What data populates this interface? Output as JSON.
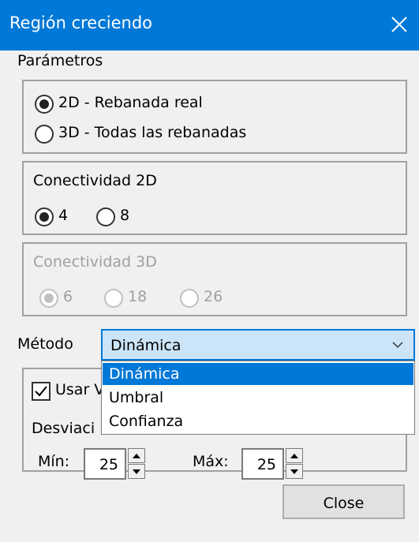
{
  "window": {
    "title": "Región creciendo"
  },
  "params": {
    "label": "Parámetros",
    "options": [
      "2D - Rebanada real",
      "3D - Todas las rebanadas"
    ],
    "selected": "2D - Rebanada real"
  },
  "conn2d": {
    "label": "Conectividad 2D",
    "options": [
      "4",
      "8"
    ],
    "selected": "4"
  },
  "conn3d": {
    "label": "Conectividad 3D",
    "options": [
      "6",
      "18",
      "26"
    ],
    "selected": "6",
    "enabled": false
  },
  "method": {
    "label": "Método",
    "value": "Dinámica",
    "options": [
      "Dinámica",
      "Umbral",
      "Confianza"
    ],
    "dropdown_open": true
  },
  "options_group": {
    "checkbox_label_visible": "Usar V",
    "checkbox_checked": true,
    "deviation_label_visible": "Desviaci",
    "min_label": "Mín:",
    "min_value": "25",
    "max_label": "Máx:",
    "max_value": "25"
  },
  "buttons": {
    "close": "Close"
  },
  "colors": {
    "accent": "#0078d7",
    "combo_bg": "#cce4f7",
    "disabled_text": "#a0a0a0"
  }
}
